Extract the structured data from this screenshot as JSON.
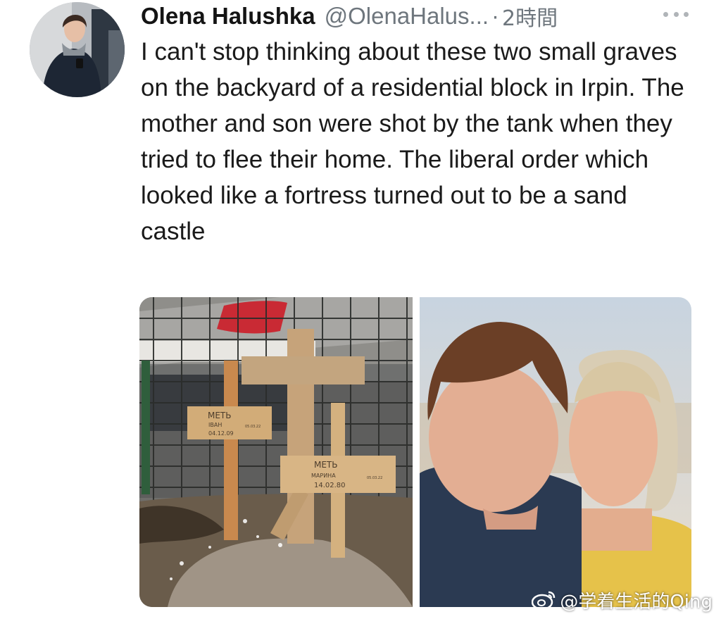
{
  "tweet": {
    "author_name": "Olena Halushka",
    "author_handle": "@OlenaHalus...",
    "separator": "·",
    "time": "2時間",
    "text": "I can't stop thinking about these two small graves on the backyard of a residential block in Irpin. The mother and son were shot by the tank when they tried to flee their home. The liberal order which looked like a fortress turned out to be a sand castle",
    "more_icon": "more-horizontal-icon",
    "media": {
      "left_photo": {
        "sign_top": {
          "line1": "МЕТЬ",
          "line2": "ІВАН",
          "line3": "04.12.09",
          "corner": "05.03.22"
        },
        "sign_bottom": {
          "line1": "МЕТЬ",
          "line2": "МАРИНА",
          "line3": "14.02.80",
          "corner": "05.03.22"
        }
      }
    }
  },
  "watermark": {
    "icon": "weibo-icon",
    "text": "@学着生活的Qing"
  },
  "colors": {
    "name": "#141414",
    "secondary": "#6e767d",
    "background": "#ffffff"
  }
}
